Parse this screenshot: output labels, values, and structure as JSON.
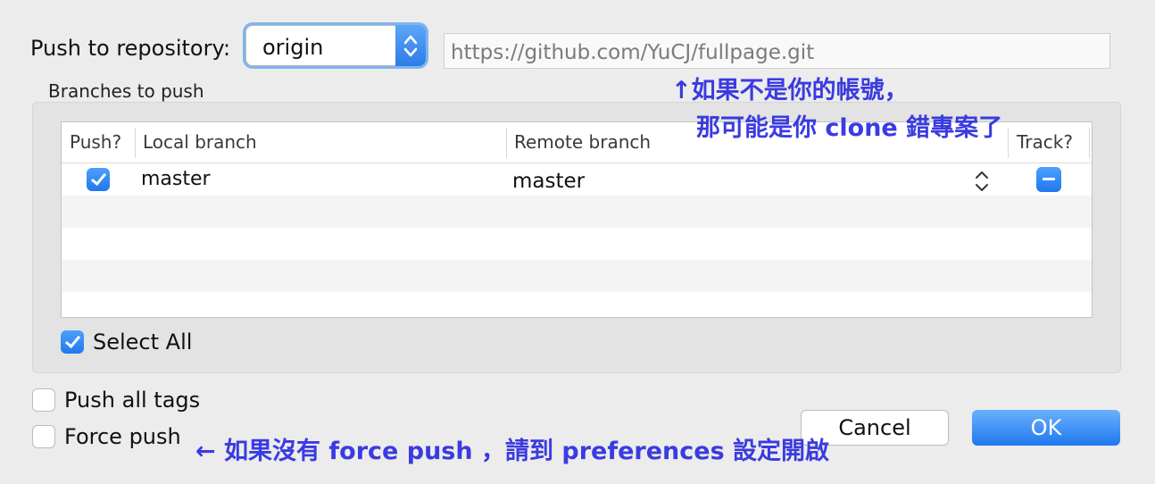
{
  "dialog": {
    "repo_label": "Push to repository:",
    "repo_selected": "origin",
    "repo_url": "https://github.com/YuCJ/fullpage.git",
    "branches_title": "Branches to push",
    "columns": [
      "Push?",
      "Local branch",
      "Remote branch",
      "Track?"
    ],
    "rows": [
      {
        "push": true,
        "local": "master",
        "remote": "master",
        "track": "mixed"
      }
    ],
    "select_all_label": "Select All",
    "select_all_checked": true,
    "push_all_tags_label": "Push all tags",
    "push_all_tags_checked": false,
    "force_push_label": "Force push",
    "force_push_checked": false,
    "cancel_label": "Cancel",
    "ok_label": "OK"
  },
  "annotations": {
    "account_note_line1": "↑如果不是你的帳號，",
    "account_note_line2": "那可能是你 clone 錯專案了",
    "force_push_note": "← 如果沒有 force push ，請到 preferences 設定開啟"
  },
  "colors": {
    "accent": "#1f78ee",
    "annotation": "#3a3be0",
    "background": "#ececec"
  }
}
